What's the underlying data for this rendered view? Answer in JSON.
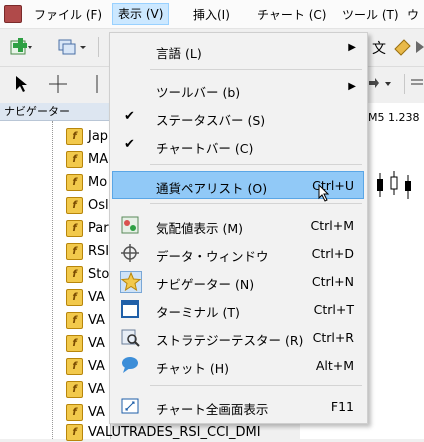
{
  "menubar": {
    "items": [
      "ファイル (F)",
      "表示 (V)",
      "挿入(I)",
      "チャート (C)",
      "ツール (T)",
      "ウ"
    ]
  },
  "toolbar": {
    "partial_text": "文"
  },
  "chart": {
    "header_text": "M5  1.238"
  },
  "navigator": {
    "title": "ナビゲーター",
    "items": [
      "Jap",
      "MA",
      "Mo",
      "Osl",
      "Par",
      "RSI",
      "Sto",
      "VA",
      "VA",
      "VA",
      "VA",
      "VA",
      "VA",
      "VALUTRADES_RSI_CCI_DMI"
    ]
  },
  "view_menu": {
    "items": [
      {
        "label": "言語 (L)",
        "submenu": true
      },
      {
        "label": "ツールバー (b)",
        "submenu": true
      },
      {
        "label": "ステータスバー (S)",
        "checked": true
      },
      {
        "label": "チャートバー (C)",
        "checked": true
      },
      {
        "label": "通貨ペアリスト (O)",
        "shortcut": "Ctrl+U",
        "icon": "market-watch-icon"
      },
      {
        "label": "気配値表示 (M)",
        "shortcut": "Ctrl+M",
        "icon": "quotes-icon"
      },
      {
        "label": "データ・ウィンドウ",
        "shortcut": "Ctrl+D",
        "icon": "crosshair-icon"
      },
      {
        "label": "ナビゲーター (N)",
        "shortcut": "Ctrl+N",
        "icon": "navigator-star-icon"
      },
      {
        "label": "ターミナル (T)",
        "shortcut": "Ctrl+T",
        "icon": "terminal-icon"
      },
      {
        "label": "ストラテジーテスター (R)",
        "shortcut": "Ctrl+R",
        "icon": "strategy-tester-icon"
      },
      {
        "label": "チャット (H)",
        "shortcut": "Alt+M",
        "icon": "chat-icon"
      },
      {
        "label": "チャート全画面表示",
        "shortcut": "F11",
        "icon": "fullscreen-icon"
      }
    ]
  },
  "colors": {
    "highlight": "#91c9f7",
    "menu_active": "#cce8ff"
  }
}
